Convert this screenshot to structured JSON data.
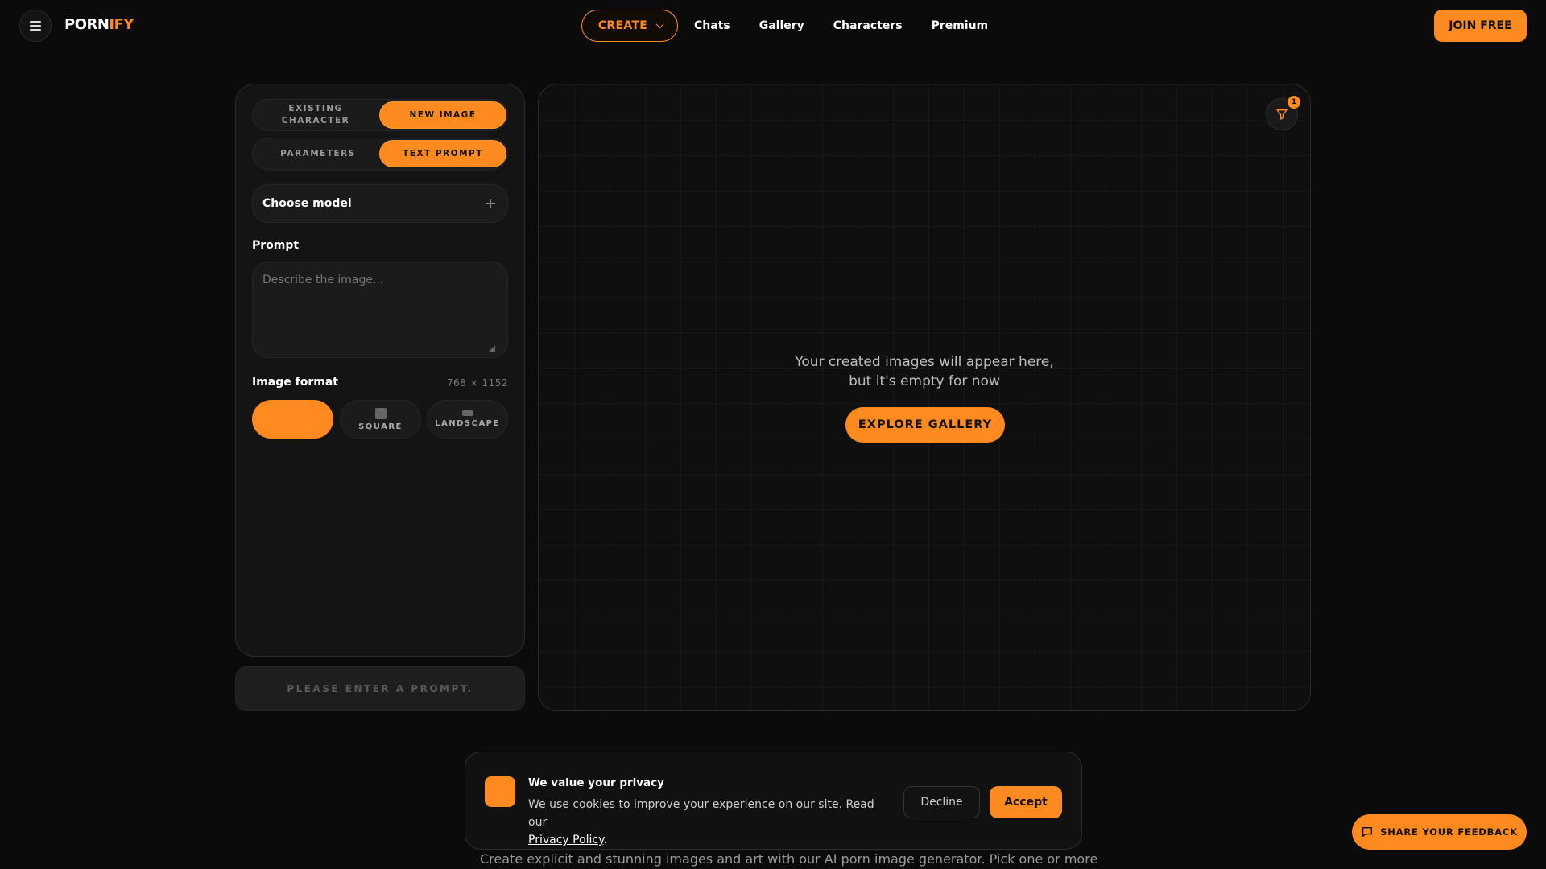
{
  "header": {
    "logo_part1": "PORN",
    "logo_part2": "IFY",
    "create_label": "CREATE",
    "nav": [
      "Chats",
      "Gallery",
      "Characters",
      "Premium"
    ],
    "join_label": "JOIN FREE"
  },
  "panel": {
    "mode_tabs": [
      "EXISTING CHARACTER",
      "NEW IMAGE"
    ],
    "mode_active": "NEW IMAGE",
    "input_tabs": [
      "PARAMETERS",
      "TEXT PROMPT"
    ],
    "input_active": "TEXT PROMPT",
    "model_label": "Choose model",
    "prompt_label": "Prompt",
    "prompt_placeholder": "Describe the image...",
    "prompt_value": "",
    "format_label": "Image format",
    "format_dims": "768 × 1152",
    "formats": [
      "",
      "SQUARE",
      "LANDSCAPE"
    ],
    "generate_label": "PLEASE ENTER A PROMPT."
  },
  "results": {
    "filter_badge": "1",
    "empty_line1": "Your created images will appear here,",
    "empty_line2": "but it's empty for now",
    "explore_label": "EXPLORE GALLERY"
  },
  "cookie": {
    "title": "We value your privacy",
    "text": "We use cookies to improve your experience on our site. Read our",
    "link": "Privacy Policy",
    "decline": "Decline",
    "accept": "Accept"
  },
  "bottom_text": "Create explicit and stunning images and art with our AI porn image generator. Pick one or more",
  "feedback_label": "SHARE YOUR FEEDBACK",
  "colors": {
    "accent": "#ff8a1f",
    "background": "#0b0b0b",
    "panel": "#141414"
  },
  "icons": [
    "hamburger-icon",
    "chevron-down-icon",
    "plus-icon",
    "filter-icon",
    "chat-bubble-icon"
  ]
}
